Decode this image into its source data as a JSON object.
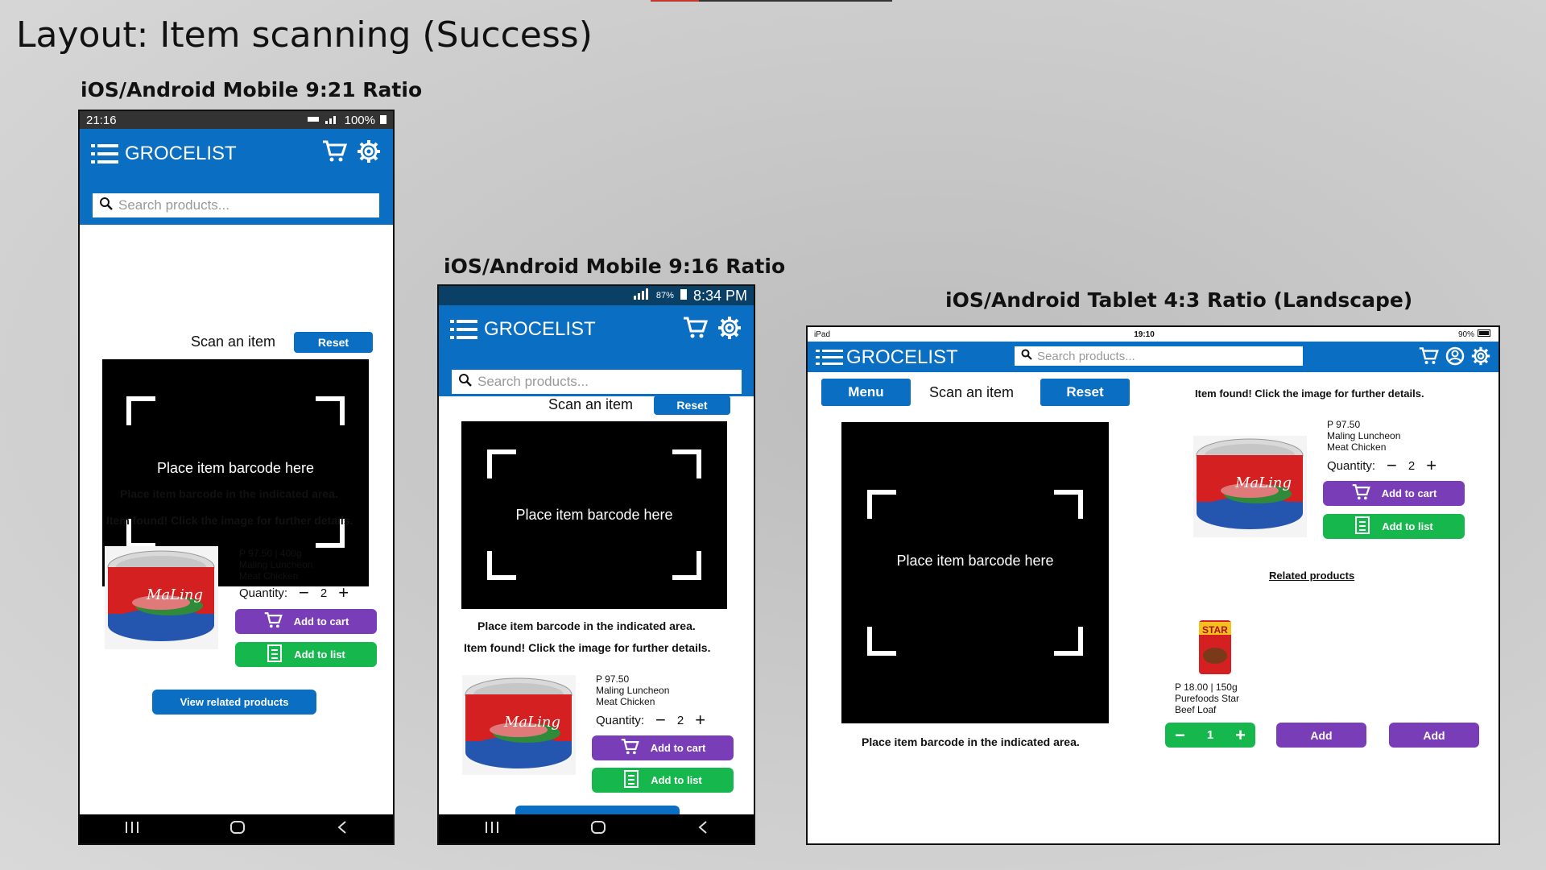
{
  "slide": {
    "title": "Layout: Item scanning (Success)",
    "label_mobile_921": "iOS/Android Mobile 9:21 Ratio",
    "label_mobile_916": "iOS/Android Mobile 9:16 Ratio",
    "label_tablet": "iOS/Android Tablet 4:3 Ratio (Landscape)"
  },
  "colors": {
    "app_blue": "#0a6ec2",
    "purple": "#7a3db8",
    "green": "#16b84e"
  },
  "app": {
    "brand": "GROCELIST",
    "search_placeholder": "Search products...",
    "scan_label": "Scan an item",
    "reset": "Reset",
    "menu": "Menu",
    "scan_hint": "Place item barcode here",
    "scan_instruction": "Place item barcode in the indicated area.",
    "found_msg": "Item found! Click the image for further details.",
    "quantity_label": "Quantity:",
    "quantity_value": "2",
    "add_to_cart": "Add to cart",
    "add_to_list": "Add to list",
    "view_related": "View related products",
    "related_title": "Related products",
    "add": "Add"
  },
  "product": {
    "price_weight": "P 97.50 | 400g",
    "price": "P 97.50",
    "name_line1": "Maling Luncheon",
    "name_line2": "Meat Chicken",
    "can_brand": "MaLing"
  },
  "related": {
    "price_weight": "P 18.00 | 150g",
    "name_line1": "Purefoods Star",
    "name_line2": "Beef Loaf",
    "qty": "1",
    "can_brand": "STAR"
  },
  "status": {
    "p1_time": "21:16",
    "p1_battery": "100%",
    "p2_battery": "87%",
    "p2_time": "8:34 PM",
    "tab_device": "iPad",
    "tab_time": "19:10",
    "tab_battery": "90%"
  }
}
